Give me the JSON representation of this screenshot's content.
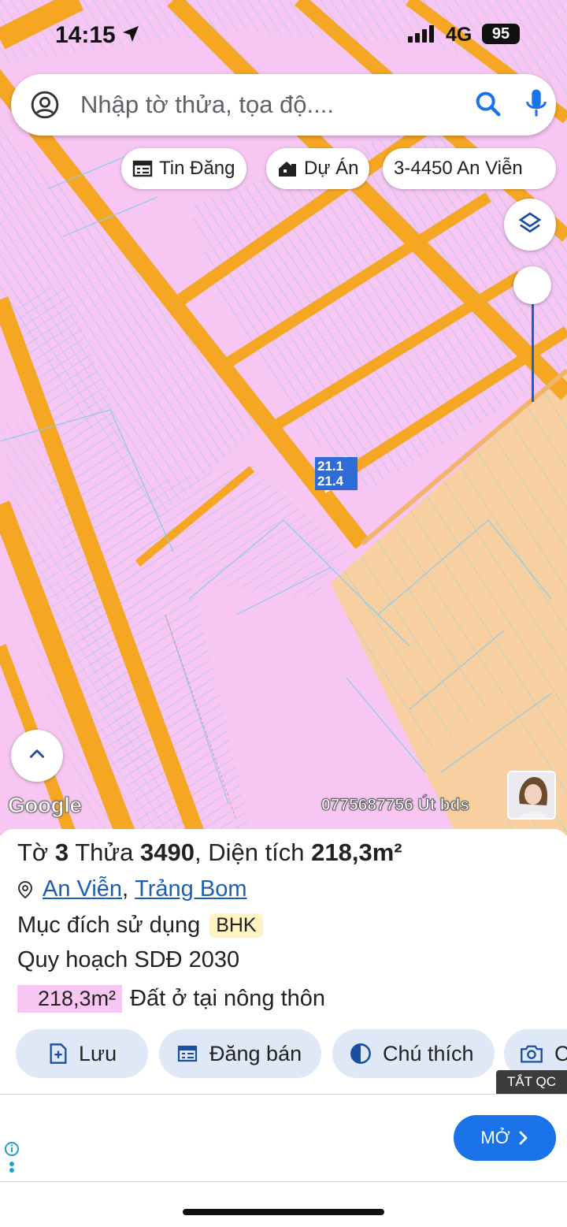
{
  "status": {
    "time": "14:15",
    "network": "4G",
    "battery": "95"
  },
  "search": {
    "placeholder": "Nhập tờ thửa, tọa độ...."
  },
  "chips": [
    {
      "label": "Tin Đăng",
      "icon": "listing-icon"
    },
    {
      "label": "Dự Án",
      "icon": "project-icon"
    },
    {
      "label": "3-4450 An Viễn"
    }
  ],
  "map": {
    "parcel_labels": [
      "21.1",
      "21.4"
    ],
    "attribution": "Google",
    "watermark": "0775687756 Út bds",
    "colors": {
      "residential": "#f7c6f3",
      "road": "#f5a623",
      "agri": "#f8cfa0",
      "parcel_line": "#7fc7e8"
    }
  },
  "parcel": {
    "title_prefix": "Tờ",
    "sheet": "3",
    "parcel_word": "Thửa",
    "parcel_no": "3490",
    "area_label": ", Diện tích",
    "area": "218,3m²",
    "ward": "An Viễn",
    "separator": ",",
    "district": "Trảng Bom",
    "purpose_label": "Mục đích sử dụng",
    "purpose_code": "BHK",
    "plan_label": "Quy hoạch SDĐ 2030",
    "plan_area": "218,3m²",
    "plan_type": "Đất ở tại nông thôn"
  },
  "actions": [
    {
      "label": "Lưu",
      "icon": "save-icon"
    },
    {
      "label": "Đăng bán",
      "icon": "listing-icon"
    },
    {
      "label": "Chú thích",
      "icon": "contrast-icon"
    },
    {
      "label": "C",
      "icon": "camera-icon"
    }
  ],
  "ad": {
    "close_label": "TẮT QC",
    "open_label": "MỞ"
  }
}
